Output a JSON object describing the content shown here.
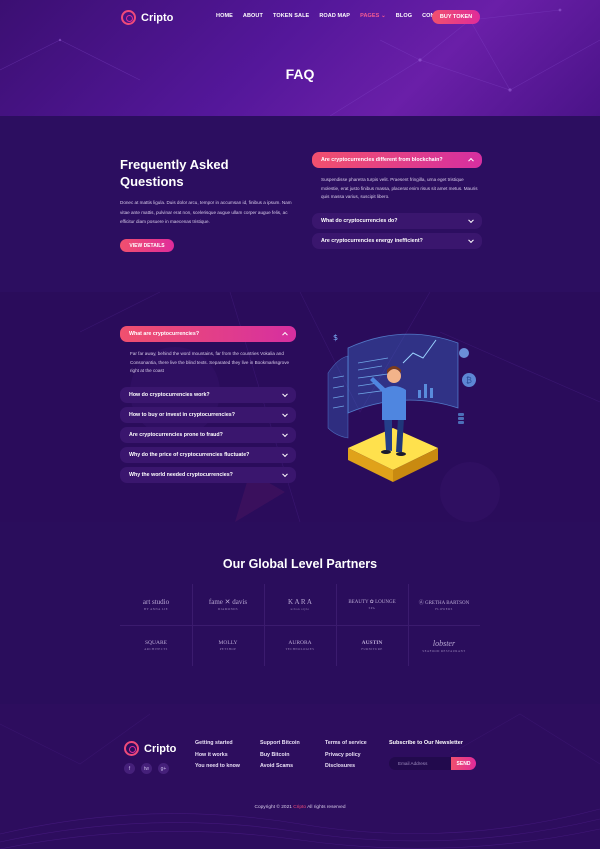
{
  "header": {
    "logo_text": "Cripto",
    "menu": [
      "HOME",
      "ABOUT",
      "TOKEN SALE",
      "ROAD MAP",
      "PAGES",
      "BLOG",
      "CONTACT"
    ],
    "active_menu": "PAGES",
    "buy_button": "BUY TOKEN",
    "page_title": "FAQ"
  },
  "faq_intro": {
    "heading": "Frequently Asked Questions",
    "text": "Donec at mattis ligula. Duis dolor arcu, tempor in accumsan id, finibus a ipsum. Nam vitae ante mattis, pulvinar erat non, scelerisque augue ullam corper augue felis, ac efficitur diam posuere in maecenas tristique.",
    "button": "VIEW DETAILS"
  },
  "faq_top": {
    "items": [
      {
        "q": "Are cryptocurrencies different from blockchain?",
        "open": true,
        "a": "Suspendisse pharetra turpis velit. Praesent fringilla, urna eget tristique molestie, erat justo finibus massa, placerat enim risus sit amet metus. Mauris quis massa varius, suscipit libero."
      },
      {
        "q": "What do cryptocurrencies do?",
        "open": false
      },
      {
        "q": "Are cryptocurrencies energy inefficient?",
        "open": false
      }
    ]
  },
  "faq_bottom": {
    "items": [
      {
        "q": "What are cryptocurrencies?",
        "open": true,
        "a": "Far far away, behind the word mountains, far from the countries Vokalia and Consonantia, there live the blind texts. Separated they live in Bookmarksgrove right at the coast"
      },
      {
        "q": "How do cryptocurrencies work?",
        "open": false
      },
      {
        "q": "How to buy or invest in cryptocurrencies?",
        "open": false
      },
      {
        "q": "Are cryptocurrencies prone to fraud?",
        "open": false
      },
      {
        "q": "Why do the price of cryptocurrencies fluctuate?",
        "open": false
      },
      {
        "q": "Why the world needed cryptocurrencies?",
        "open": false
      }
    ]
  },
  "partners": {
    "title": "Our Global Level Partners",
    "logos": [
      {
        "name": "art studio",
        "sub": "BY ANNA LIE"
      },
      {
        "name": "fame ✕ davis",
        "sub": "DIAMONDS"
      },
      {
        "name": "K A R A",
        "sub": "urban style"
      },
      {
        "name": "BEAUTY ✿ LOUNGE",
        "sub": "SPA"
      },
      {
        "name": "Ⓐ GRETHA BARTSON",
        "sub": "FLOWERS"
      },
      {
        "name": "SQUARE",
        "sub": "ARCHITECTS"
      },
      {
        "name": "MOLLY",
        "sub": "PETSHOP"
      },
      {
        "name": "AURORA",
        "sub": "TECHNOLOGIES"
      },
      {
        "name": "AUSTIN",
        "sub": "FURNITURE"
      },
      {
        "name": "lobster",
        "sub": "SEAFOOD RESTAURANT"
      }
    ]
  },
  "footer": {
    "logo_text": "Cripto",
    "social_icons": [
      "f",
      "tw",
      "g+"
    ],
    "col1": [
      "Getting started",
      "How it works",
      "You need to know"
    ],
    "col2": [
      "Support Bitcoin",
      "Buy Bitcoin",
      "Avoid Scams"
    ],
    "col3": [
      "Terms of service",
      "Privacy policy",
      "Disclosures"
    ],
    "newsletter_title": "Subscribe to Our Newsletter",
    "email_placeholder": "Email Address",
    "send_button": "SEND",
    "copyright_pre": "Copyright © 2021 ",
    "copyright_brand": "Cripto",
    "copyright_post": " All rights reserved"
  },
  "colors": {
    "accent_start": "#f0506e",
    "accent_end": "#e02b9a",
    "background": "#2a0d5c"
  }
}
